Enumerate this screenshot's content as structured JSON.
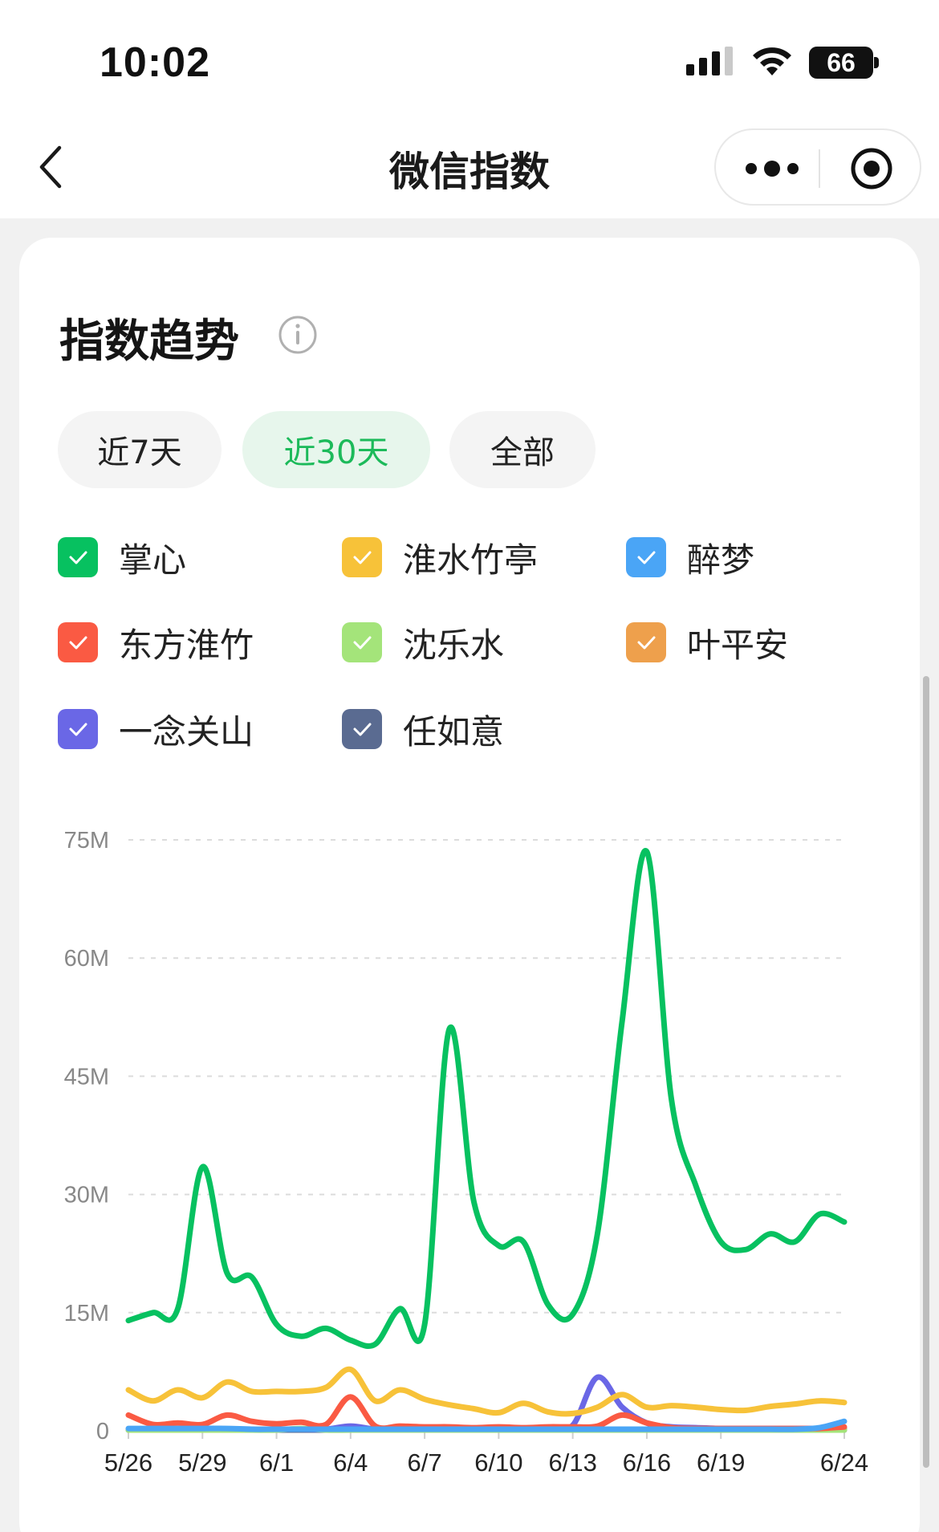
{
  "status_bar": {
    "time": "10:02",
    "battery": "66"
  },
  "nav": {
    "title": "微信指数"
  },
  "section": {
    "title": "指数趋势"
  },
  "range_tabs": [
    {
      "label": "近7天",
      "active": false
    },
    {
      "label": "近30天",
      "active": true
    },
    {
      "label": "全部",
      "active": false
    }
  ],
  "legend": [
    {
      "label": "掌心",
      "color": "#07c160"
    },
    {
      "label": "淮水竹亭",
      "color": "#f7c239"
    },
    {
      "label": "醉梦",
      "color": "#4aa5f6"
    },
    {
      "label": "东方淮竹",
      "color": "#fa5a43"
    },
    {
      "label": "沈乐水",
      "color": "#a4e47a"
    },
    {
      "label": "叶平安",
      "color": "#eea04c"
    },
    {
      "label": "一念关山",
      "color": "#6a67e6"
    },
    {
      "label": "任如意",
      "color": "#5a6b91"
    }
  ],
  "chart_data": {
    "type": "line",
    "x": [
      "5/26",
      "5/27",
      "5/28",
      "5/29",
      "5/30",
      "5/31",
      "6/1",
      "6/2",
      "6/3",
      "6/4",
      "6/5",
      "6/6",
      "6/7",
      "6/8",
      "6/9",
      "6/10",
      "6/11",
      "6/12",
      "6/13",
      "6/14",
      "6/15",
      "6/16",
      "6/17",
      "6/18",
      "6/19",
      "6/20",
      "6/21",
      "6/22",
      "6/23",
      "6/24"
    ],
    "xtick_labels": [
      "5/26",
      "5/29",
      "6/1",
      "6/4",
      "6/7",
      "6/10",
      "6/13",
      "6/16",
      "6/19",
      "6/24"
    ],
    "ytick_labels": [
      "0",
      "15M",
      "30M",
      "45M",
      "60M",
      "75M"
    ],
    "ylim": [
      0,
      75
    ],
    "grid": true,
    "series": [
      {
        "name": "掌心",
        "color": "#07c160",
        "values": [
          14,
          15,
          15.5,
          33.5,
          20,
          19.5,
          13.5,
          12,
          13,
          11.5,
          11,
          15.5,
          13.5,
          51,
          29,
          23.5,
          24,
          16,
          14.8,
          25,
          52,
          73.5,
          42,
          31,
          24,
          23,
          25,
          24,
          27.5,
          26.5
        ]
      },
      {
        "name": "淮水竹亭",
        "color": "#f7c239",
        "values": [
          5.2,
          3.8,
          5.2,
          4.2,
          6.2,
          5,
          5,
          5,
          5.5,
          7.8,
          3.8,
          5.2,
          4,
          3.3,
          2.8,
          2.3,
          3.5,
          2.4,
          2.2,
          3,
          4.6,
          3,
          3.2,
          3,
          2.7,
          2.6,
          3.1,
          3.4,
          3.8,
          3.6
        ]
      },
      {
        "name": "醉梦",
        "color": "#4aa5f6",
        "values": [
          0.3,
          0.3,
          0.3,
          0.3,
          0.3,
          0.2,
          0.2,
          0.2,
          0.2,
          0.2,
          0.2,
          0.2,
          0.2,
          0.2,
          0.2,
          0.2,
          0.2,
          0.2,
          0.2,
          0.2,
          0.2,
          0.2,
          0.2,
          0.2,
          0.2,
          0.2,
          0.2,
          0.2,
          0.4,
          1.2
        ]
      },
      {
        "name": "东方淮竹",
        "color": "#fa5a43",
        "values": [
          2,
          0.8,
          1,
          0.8,
          2,
          1.2,
          0.9,
          1.1,
          0.8,
          4.3,
          0.6,
          0.6,
          0.5,
          0.5,
          0.4,
          0.5,
          0.4,
          0.5,
          0.5,
          0.6,
          2,
          1,
          0.4,
          0.3,
          0.3,
          0.3,
          0.3,
          0.3,
          0.3,
          0.5
        ]
      },
      {
        "name": "沈乐水",
        "color": "#a4e47a",
        "values": [
          0.1,
          0.1,
          0.1,
          0.1,
          0.1,
          0.1,
          0.1,
          0.3,
          0.1,
          0.1,
          0.1,
          0.1,
          0.1,
          0.1,
          0.1,
          0.1,
          0.1,
          0.1,
          0.1,
          0.1,
          0.1,
          0.1,
          0.1,
          0.1,
          0.1,
          0.1,
          0.1,
          0.1,
          0.1,
          0.1
        ]
      },
      {
        "name": "叶平安",
        "color": "#eea04c",
        "values": [
          0.2,
          0.2,
          0.2,
          0.2,
          0.2,
          0.2,
          0.2,
          0.2,
          0.2,
          0.2,
          0.2,
          0.2,
          0.2,
          0.2,
          0.2,
          0.2,
          0.2,
          0.2,
          0.2,
          0.2,
          0.2,
          0.2,
          0.2,
          0.2,
          0.2,
          0.2,
          0.2,
          0.2,
          0.2,
          0.2
        ]
      },
      {
        "name": "一念关山",
        "color": "#6a67e6",
        "values": [
          0.2,
          0.2,
          0.2,
          0.2,
          0.2,
          0.2,
          0.2,
          0.2,
          0.2,
          0.6,
          0.2,
          0.2,
          0.2,
          0.2,
          0.2,
          0.3,
          0.3,
          0.3,
          0.7,
          6.8,
          3,
          1,
          0.5,
          0.4,
          0.3,
          0.3,
          0.3,
          0.3,
          0.3,
          0.3
        ]
      },
      {
        "name": "任如意",
        "color": "#5a6b91",
        "values": [
          0.1,
          0.1,
          0.1,
          0.1,
          0.1,
          0.1,
          0.1,
          0.1,
          0.1,
          0.1,
          0.1,
          0.1,
          0.1,
          0.1,
          0.1,
          0.1,
          0.1,
          0.1,
          0.1,
          0.1,
          0.1,
          0.1,
          0.1,
          0.1,
          0.1,
          0.1,
          0.1,
          0.1,
          0.1,
          0.1
        ]
      }
    ]
  }
}
